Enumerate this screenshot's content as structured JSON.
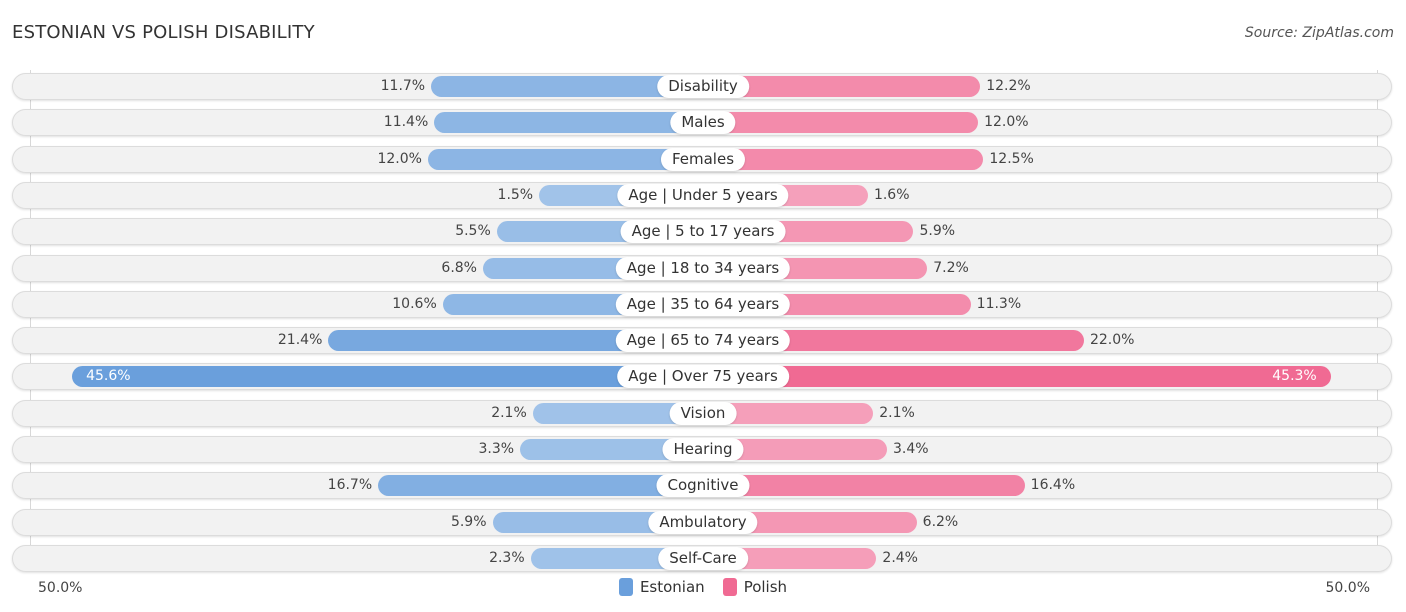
{
  "header": {
    "title": "ESTONIAN VS POLISH DISABILITY",
    "source": "Source: ZipAtlas.com"
  },
  "chart_data": {
    "type": "bar",
    "orientation": "horizontal-diverging",
    "title": "ESTONIAN VS POLISH DISABILITY",
    "categories": [
      "Disability",
      "Males",
      "Females",
      "Age | Under 5 years",
      "Age | 5 to 17 years",
      "Age | 18 to 34 years",
      "Age | 35 to 64 years",
      "Age | 65 to 74 years",
      "Age | Over 75 years",
      "Vision",
      "Hearing",
      "Cognitive",
      "Ambulatory",
      "Self-Care"
    ],
    "series": [
      {
        "name": "Estonian",
        "color": "#6a9fdc",
        "side": "left",
        "values": [
          11.7,
          11.4,
          12.0,
          1.5,
          5.5,
          6.8,
          10.6,
          21.4,
          45.6,
          2.1,
          3.3,
          16.7,
          5.9,
          2.3
        ],
        "labels": [
          "11.7%",
          "11.4%",
          "12.0%",
          "1.5%",
          "5.5%",
          "6.8%",
          "10.6%",
          "21.4%",
          "45.6%",
          "2.1%",
          "3.3%",
          "16.7%",
          "5.9%",
          "2.3%"
        ]
      },
      {
        "name": "Polish",
        "color": "#f06a93",
        "side": "right",
        "values": [
          12.2,
          12.0,
          12.5,
          1.6,
          5.9,
          7.2,
          11.3,
          22.0,
          45.3,
          2.1,
          3.4,
          16.4,
          6.2,
          2.4
        ],
        "labels": [
          "12.2%",
          "12.0%",
          "12.5%",
          "1.6%",
          "5.9%",
          "7.2%",
          "11.3%",
          "22.0%",
          "45.3%",
          "2.1%",
          "3.4%",
          "16.4%",
          "6.2%",
          "2.4%"
        ]
      }
    ],
    "axis": {
      "left_label": "50.0%",
      "right_label": "50.0%",
      "max": 50.0
    },
    "legend": {
      "position": "bottom-center",
      "entries": [
        "Estonian",
        "Polish"
      ]
    },
    "grid": false
  }
}
